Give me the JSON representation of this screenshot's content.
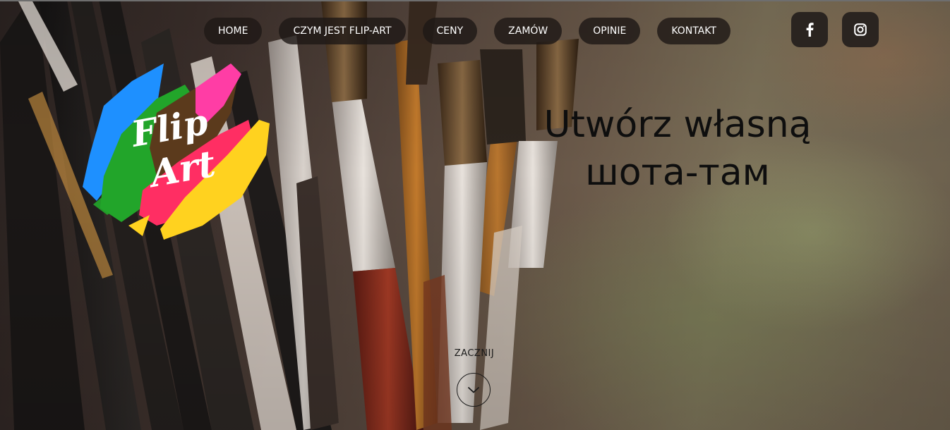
{
  "nav": {
    "items": [
      {
        "label": "HOME"
      },
      {
        "label": "CZYM JEST FLIP-ART"
      },
      {
        "label": "CENY"
      },
      {
        "label": "ZAMÓW"
      },
      {
        "label": "OPINIE"
      },
      {
        "label": "KONTAKT"
      }
    ]
  },
  "social": {
    "facebook_icon": "facebook-icon",
    "instagram_icon": "instagram-icon"
  },
  "logo": {
    "text_line1": "Flip",
    "text_line2": "Art",
    "colors": [
      "#1e90ff",
      "#22a52a",
      "#ff2e63",
      "#ffd21f",
      "#ff3da5",
      "#5b3a1c"
    ]
  },
  "hero": {
    "headline_line1": "Utwórz własną",
    "headline_line2": "шота-там",
    "start_label": "ZACZNIJ",
    "start_icon": "chevron-down-icon"
  }
}
